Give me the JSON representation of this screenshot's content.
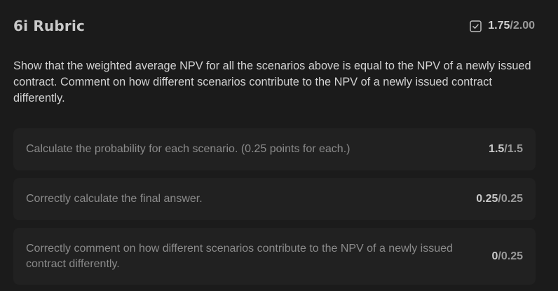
{
  "rubric": {
    "title": "6i Rubric",
    "score_earned": "1.75",
    "score_sep": "/",
    "score_total": "2.00",
    "question": "Show that the weighted average NPV for all the scenarios above is equal to the NPV of a newly issued contract. Comment on how different scenarios contribute to the NPV of a newly issued contract differently.",
    "items": [
      {
        "text": "Calculate the probability for each scenario. (0.25 points for each.)",
        "earned": "1.5",
        "sep": "/",
        "total": "1.5"
      },
      {
        "text": "Correctly calculate the final answer.",
        "earned": "0.25",
        "sep": "/",
        "total": "0.25"
      },
      {
        "text": "Correctly comment on how different scenarios contribute to the NPV of a newly issued contract differently.",
        "earned": "0",
        "sep": "/",
        "total": "0.25"
      }
    ]
  },
  "colors": {
    "background": "#1b1b1b",
    "item_background": "#212121",
    "muted_text": "#8b8b8b"
  },
  "icons": {
    "score": "checkbox-check-icon"
  }
}
